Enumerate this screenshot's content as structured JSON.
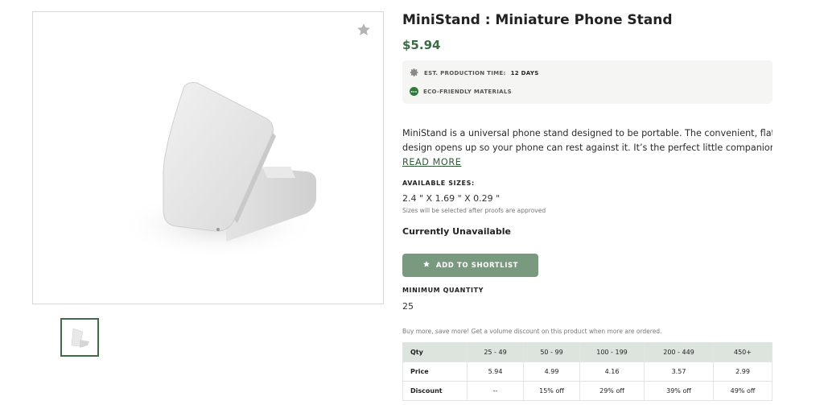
{
  "product": {
    "title": "MiniStand : Miniature Phone Stand",
    "price": "$5.94"
  },
  "icons": {
    "favorite": "star-icon",
    "production": "gear-icon",
    "eco": "eco-badge-icon",
    "shortlist": "star-icon"
  },
  "info": {
    "production_label": "EST. PRODUCTION TIME:",
    "production_value": "12 DAYS",
    "eco_badge_text": "ECO",
    "eco_label": "ECO-FRIENDLY MATERIALS"
  },
  "description": {
    "line1": "MiniStand is a universal phone stand designed to be portable.  The convenient, flat",
    "line2": "design opens up so your phone can rest against it.  It’s the perfect little companion…",
    "read_more": "READ MORE"
  },
  "sizes": {
    "label": "AVAILABLE SIZES:",
    "value": "2.4 \" X 1.69 \" X 0.29 \"",
    "note": "Sizes will be selected after proofs are approved"
  },
  "availability": "Currently Unavailable",
  "shortlist_button": "ADD TO SHORTLIST",
  "minimum_quantity": {
    "label": "MINIMUM QUANTITY",
    "value": "25"
  },
  "volume_note": "Buy more, save more! Get a volume discount on this product when more are ordered.",
  "pricing_table": {
    "header": [
      "Qty",
      "25 - 49",
      "50 - 99",
      "100 - 199",
      "200 - 449",
      "450+"
    ],
    "price_row": [
      "Price",
      "5.94",
      "4.99",
      "4.16",
      "3.57",
      "2.99"
    ],
    "discount_row": [
      "Discount",
      "--",
      "15% off",
      "29% off",
      "39% off",
      "49% off"
    ]
  },
  "colors": {
    "accent_green": "#3d6b46",
    "button_green": "#7a9a80",
    "table_header": "#dde3dd",
    "info_box": "#f5f5f3"
  }
}
